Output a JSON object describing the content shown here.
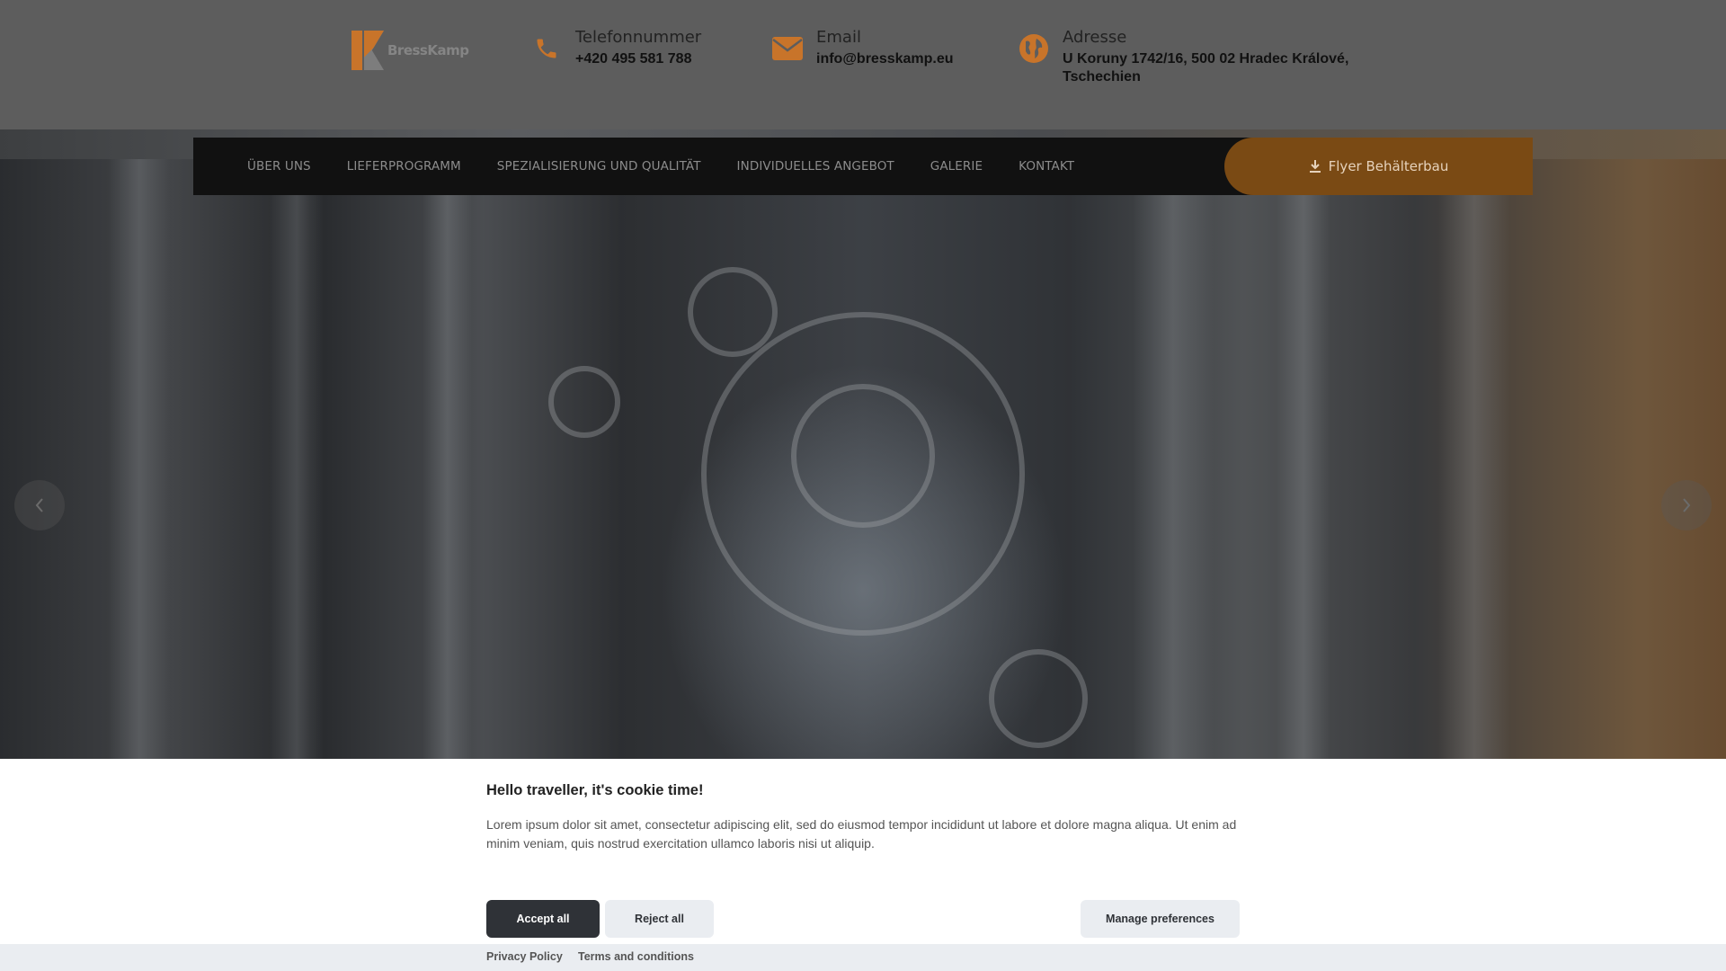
{
  "brand": {
    "logo_text": "BressKamp",
    "accent": "#c8742a"
  },
  "contacts": [
    {
      "icon": "phone-icon",
      "label": "Telefonnummer",
      "value": "+420 495 581 788"
    },
    {
      "icon": "envelope-icon",
      "label": "Email",
      "value": "info@bresskamp.eu"
    },
    {
      "icon": "globe-icon",
      "label": "Adresse",
      "value": "U Koruny 1742/16, 500 02 Hradec Králové, Tschechien"
    }
  ],
  "nav": {
    "items": [
      "Über uns",
      "Lieferprogramm",
      "Spezialisierung und Qualität",
      "Individuelles Angebot",
      "Galerie",
      "Kontakt"
    ],
    "cta_label": "Flyer Behälterbau",
    "cta_icon": "download-icon"
  },
  "slider": {
    "prev_icon": "chevron-left-icon",
    "next_icon": "chevron-right-icon"
  },
  "cookie": {
    "title": "Hello traveller, it's cookie time!",
    "description": "Lorem ipsum dolor sit amet, consectetur adipiscing elit, sed do eiusmod tempor incididunt ut labore et dolore magna aliqua. Ut enim ad minim veniam, quis nostrud exercitation ullamco laboris nisi ut aliquip.",
    "accept_label": "Accept all",
    "reject_label": "Reject all",
    "manage_label": "Manage preferences",
    "privacy_label": "Privacy Policy",
    "terms_label": "Terms and conditions"
  }
}
